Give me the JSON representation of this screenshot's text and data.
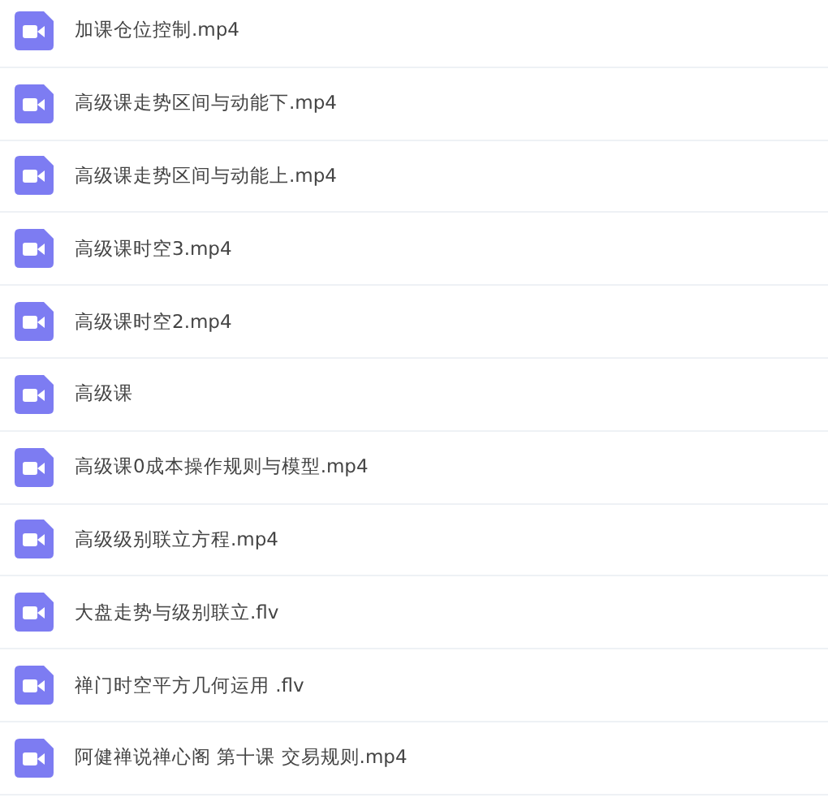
{
  "files": [
    {
      "name": "加课仓位控制.mp4"
    },
    {
      "name": "高级课走势区间与动能下.mp4"
    },
    {
      "name": "高级课走势区间与动能上.mp4"
    },
    {
      "name": "高级课时空3.mp4"
    },
    {
      "name": "高级课时空2.mp4"
    },
    {
      "name": "高级课"
    },
    {
      "name": "高级课0成本操作规则与模型.mp4"
    },
    {
      "name": "高级级别联立方程.mp4"
    },
    {
      "name": "大盘走势与级别联立.flv"
    },
    {
      "name": "禅门时空平方几何运用 .flv"
    },
    {
      "name": "阿健禅说禅心阁 第十课 交易规则.mp4"
    }
  ]
}
